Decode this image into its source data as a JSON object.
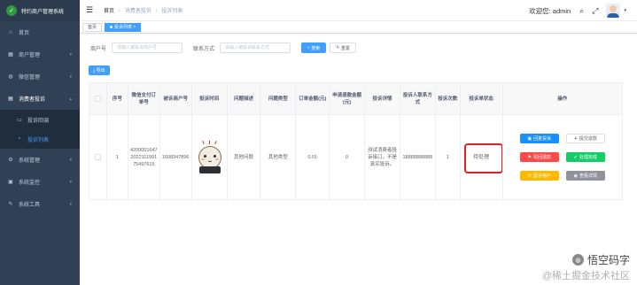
{
  "app": {
    "title": "特约商户管理系统"
  },
  "sidebar": {
    "items": [
      {
        "label": "首页",
        "icon": "home-icon"
      },
      {
        "label": "商户管理",
        "icon": "store-icon"
      },
      {
        "label": "微信管理",
        "icon": "wechat-icon"
      },
      {
        "label": "消费者投诉",
        "icon": "complaint-icon",
        "children": [
          {
            "label": "投诉回调",
            "icon": "callback-icon"
          },
          {
            "label": "投诉列表",
            "icon": "list-icon"
          }
        ]
      },
      {
        "label": "系统管理",
        "icon": "gear-icon"
      },
      {
        "label": "系统监控",
        "icon": "monitor-icon"
      },
      {
        "label": "系统工具",
        "icon": "tool-icon"
      }
    ]
  },
  "header": {
    "breadcrumb": [
      "首页",
      "消费者投诉",
      "投诉列表"
    ],
    "welcome": "欢迎您: admin"
  },
  "tags": [
    {
      "label": "首页"
    },
    {
      "label": "投诉列表"
    }
  ],
  "search": {
    "merchant_label": "商户号",
    "merchant_placeholder": "请输入被投诉商户号",
    "contact_label": "联系方式",
    "contact_placeholder": "请输入被投诉联系方式",
    "search_btn": "搜索",
    "reset_btn": "重置"
  },
  "toolbar": {
    "export_label": "导出"
  },
  "table": {
    "headers": [
      "",
      "序号",
      "微信支付订单号",
      "被诉商户号",
      "投诉时间",
      "问题描述",
      "问题类型",
      "订单金额(元)",
      "申请退款金额(元)",
      "投诉详情",
      "投诉人联系方式",
      "投诉次数",
      "投诉单状态",
      "操作"
    ],
    "rows": [
      {
        "index": "1",
        "order_no": "4200001647202211199175497615",
        "merchant_no": "1608347896",
        "problem_desc": "其他问题",
        "problem_type": "其他类型",
        "order_amount": "0.01",
        "refund_amount": "0",
        "detail": "测试消费者投诉接口，不是真实投诉。",
        "contact": "18888888888",
        "count": "1",
        "status": "待处理"
      }
    ]
  },
  "actions": [
    {
      "label": "回复投诉",
      "color": "#1890ff"
    },
    {
      "label": "提交退款",
      "color": "#ffffff"
    },
    {
      "label": "驳回退款",
      "color": "#ff4949"
    },
    {
      "label": "处理完成",
      "color": "#13ce66"
    },
    {
      "label": "留言用户",
      "color": "#ffba00"
    },
    {
      "label": "查看详情",
      "color": "#909399"
    }
  ],
  "watermark": {
    "line1": "悟空码字",
    "line2": "@稀土掘金技术社区"
  },
  "colors": {
    "sidebar": "#304156",
    "primary": "#409eff",
    "highlight": "#e02020"
  }
}
